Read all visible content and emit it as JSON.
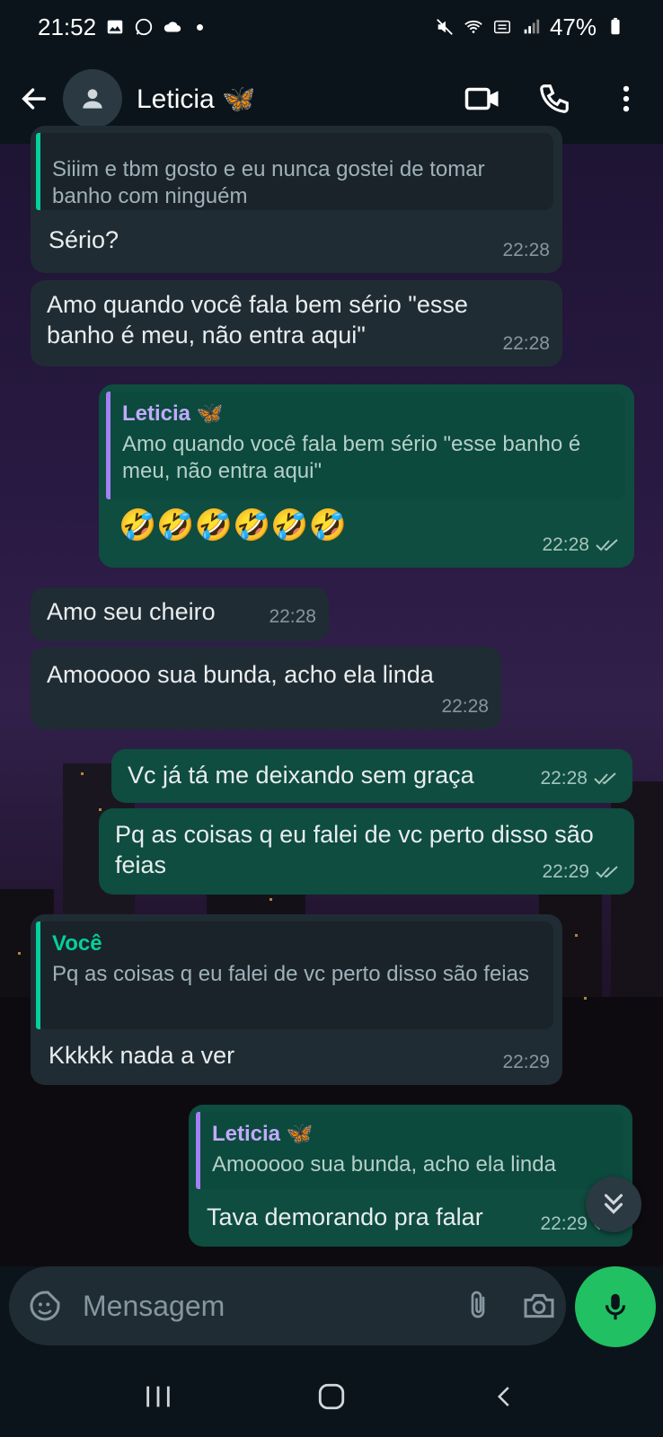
{
  "status_bar": {
    "time": "21:52",
    "battery": "47%"
  },
  "header": {
    "contact_name": "Leticia 🦋"
  },
  "messages": [
    {
      "dir": "in",
      "quote_text": "Siiim e tbm gosto e eu nunca gostei de tomar banho com ninguém",
      "text": "Sério?",
      "time": "22:28"
    },
    {
      "dir": "in",
      "text": "Amo quando você fala bem sério \"esse banho é meu, não entra aqui\"",
      "time": "22:28"
    },
    {
      "dir": "out",
      "quote_author": "Leticia 🦋",
      "quote_text": "Amo quando você fala bem sério \"esse banho é meu, não entra aqui\"",
      "text": "🤣🤣🤣🤣🤣🤣",
      "time": "22:28"
    },
    {
      "dir": "in",
      "text": "Amo seu cheiro",
      "time": "22:28"
    },
    {
      "dir": "in",
      "text": "Amooooo sua bunda, acho ela linda",
      "time": "22:28"
    },
    {
      "dir": "out",
      "text": "Vc já tá me deixando sem graça",
      "time": "22:28"
    },
    {
      "dir": "out",
      "text": "Pq as coisas q eu falei de vc perto disso são feias",
      "time": "22:29"
    },
    {
      "dir": "in",
      "quote_author": "Você",
      "quote_text": "Pq as coisas q eu falei de vc perto disso são feias",
      "text": "Kkkkk nada a ver",
      "time": "22:29"
    },
    {
      "dir": "out",
      "quote_author": "Leticia 🦋",
      "quote_text": "Amooooo sua bunda, acho ela linda",
      "text": "Tava demorando pra falar",
      "time": "22:29"
    }
  ],
  "composer": {
    "placeholder": "Mensagem"
  },
  "colors": {
    "accent": "#21c063",
    "outgoing": "#005c4b",
    "incoming": "#202c33"
  }
}
